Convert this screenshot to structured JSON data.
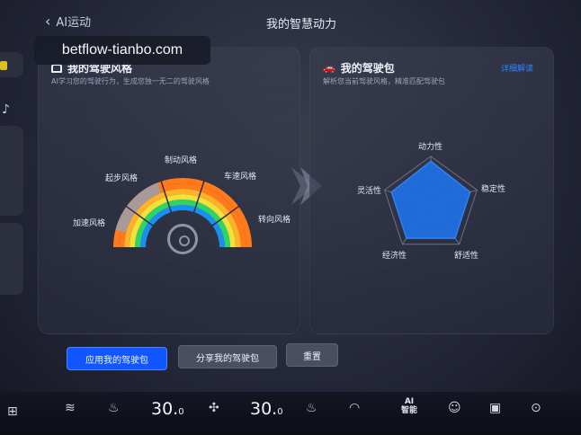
{
  "header": {
    "back_label": "AI运动",
    "title": "我的智慧动力"
  },
  "watermark": "betflow-tianbo.com",
  "left_panel": {
    "title": "我的驾驶风格",
    "subtitle": "AI学习您的驾驶行为，生成您独一无二的驾驶风格",
    "fan_labels": [
      "加速风格",
      "起步风格",
      "制动风格",
      "车速风格",
      "转向风格"
    ]
  },
  "right_panel": {
    "title": "我的驾驶包",
    "subtitle": "解析您当前驾驶风格，精准匹配驾驶包",
    "link": "详细解读",
    "radar_labels": [
      "动力性",
      "稳定性",
      "舒适性",
      "经济性",
      "灵活性"
    ],
    "radar_values": [
      0.9,
      0.85,
      0.85,
      0.85,
      0.85
    ]
  },
  "buttons": {
    "apply": "应用我的驾驶包",
    "share": "分享我的驾驶包",
    "reset": "重置"
  },
  "bottom_bar": {
    "temp_left": "30.",
    "temp_left_dec": "0",
    "temp_right": "30.",
    "temp_right_dec": "0",
    "ai_line1": "AI",
    "ai_line2": "智能"
  },
  "colors": {
    "accent": "#1256ff",
    "link": "#2f86ff",
    "radar_fill": "#1f6fe0"
  }
}
